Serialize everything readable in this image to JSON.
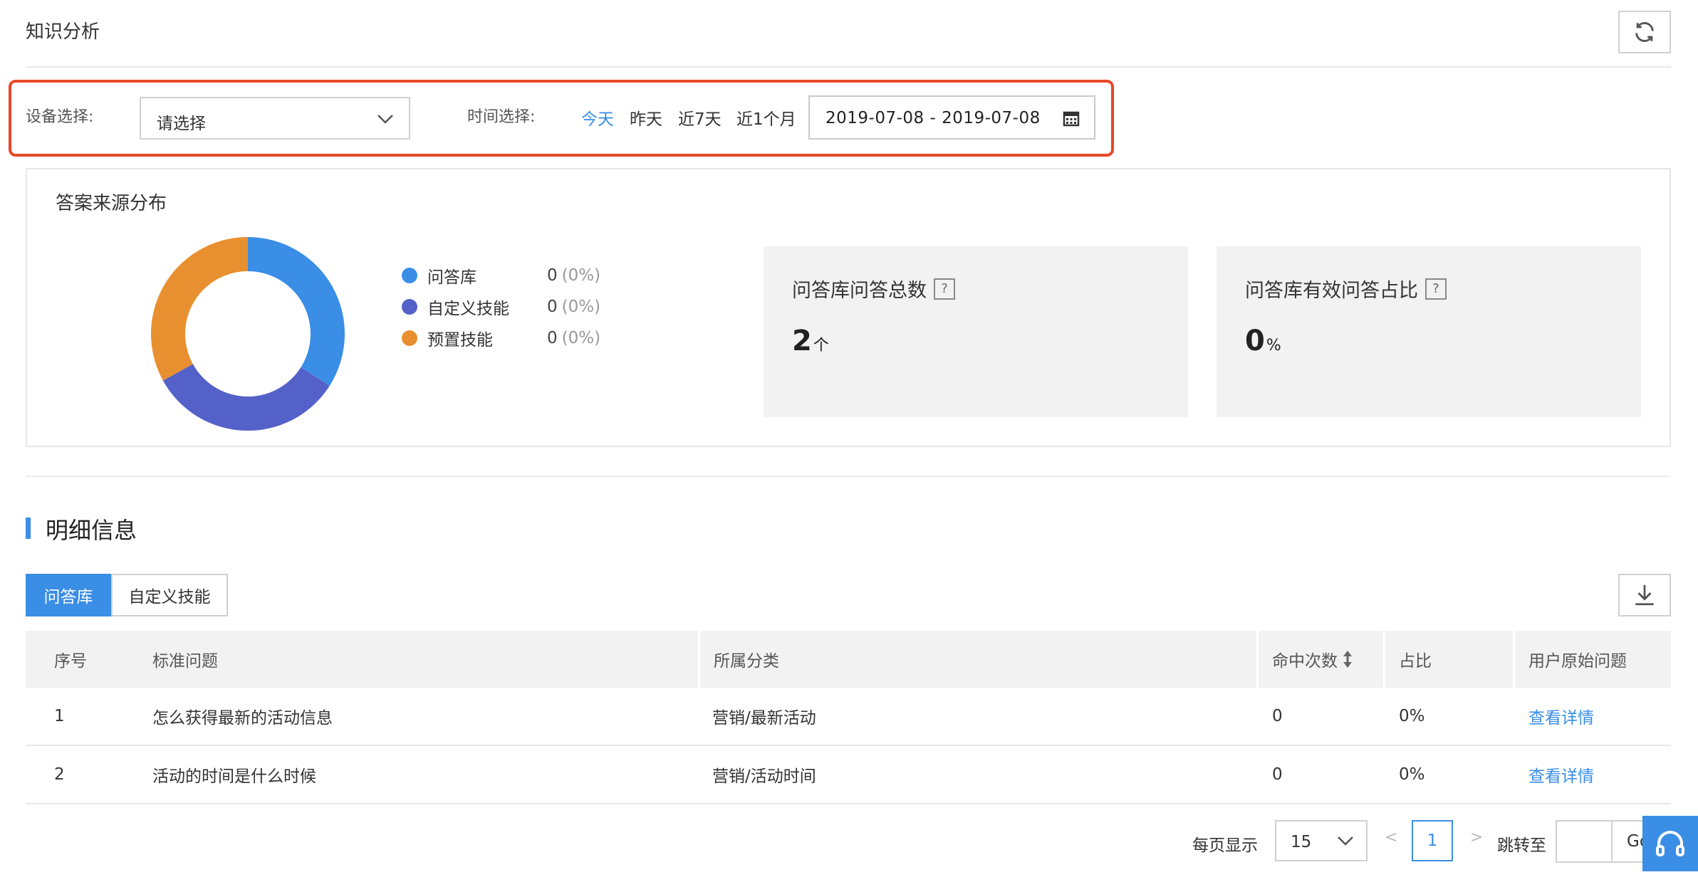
{
  "header": {
    "title": "知识分析",
    "refresh_icon": "refresh-icon"
  },
  "filters": {
    "device_label": "设备选择:",
    "device_value": "请选择",
    "time_label": "时间选择:",
    "time_options": [
      "今天",
      "昨天",
      "近7天",
      "近1个月"
    ],
    "active_time_option": "今天",
    "date_range": "2019-07-08 - 2019-07-08",
    "highlight_color": "#e8472a"
  },
  "answer_source": {
    "title": "答案来源分布",
    "legend": [
      {
        "name": "问答库",
        "value": "0",
        "pct": "(0%)",
        "color": "#3a8ee6"
      },
      {
        "name": "自定义技能",
        "value": "0",
        "pct": "(0%)",
        "color": "#5461c8"
      },
      {
        "name": "预置技能",
        "value": "0",
        "pct": "(0%)",
        "color": "#e8902f"
      }
    ],
    "donut_segments": [
      {
        "name": "问答库",
        "fraction": 0.34,
        "color": "#3a8ee6"
      },
      {
        "name": "自定义技能",
        "fraction": 0.33,
        "color": "#5461c8"
      },
      {
        "name": "预置技能",
        "fraction": 0.33,
        "color": "#e8902f"
      }
    ]
  },
  "stats": [
    {
      "title": "问答库问答总数",
      "help": "?",
      "value": "2",
      "unit": "个"
    },
    {
      "title": "问答库有效问答占比",
      "help": "?",
      "value": "0",
      "unit": "%"
    }
  ],
  "detail": {
    "title": "明细信息",
    "tabs": [
      "问答库",
      "自定义技能"
    ],
    "active_tab": "问答库",
    "columns": [
      "序号",
      "标准问题",
      "所属分类",
      "命中次数",
      "占比",
      "用户原始问题"
    ],
    "rows": [
      {
        "index": "1",
        "question": "怎么获得最新的活动信息",
        "category": "营销/最新活动",
        "hits": "0",
        "ratio": "0%",
        "action": "查看详情"
      },
      {
        "index": "2",
        "question": "活动的时间是什么时候",
        "category": "营销/活动时间",
        "hits": "0",
        "ratio": "0%",
        "action": "查看详情"
      }
    ]
  },
  "pagination": {
    "per_page_label": "每页显示",
    "per_page": "15",
    "prev": "<",
    "next": ">",
    "current_page": "1",
    "jump_label": "跳转至",
    "go_label": "Go"
  },
  "colors": {
    "accent": "#3a8ee6",
    "text": "#333333",
    "muted": "#999999"
  }
}
